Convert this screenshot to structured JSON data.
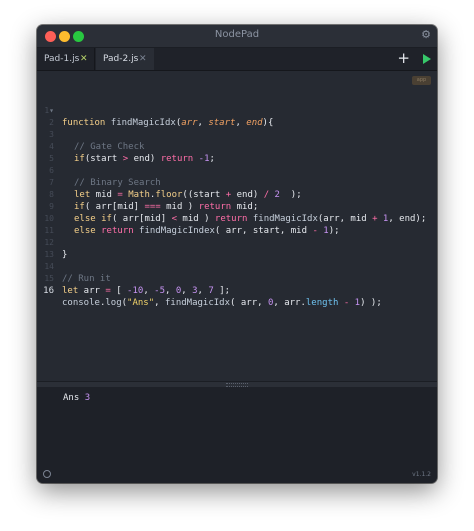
{
  "window": {
    "title": "NodePad"
  },
  "tabs": [
    {
      "label": "Pad-1.js",
      "close": "✕"
    },
    {
      "label": "Pad-2.js",
      "close": "✕"
    }
  ],
  "toolbar": {
    "add_label": "+",
    "settings_label": "⚙"
  },
  "editor": {
    "badge": "app",
    "line_numbers": [
      "1",
      "2",
      "3",
      "4",
      "5",
      "6",
      "7",
      "8",
      "9",
      "10",
      "11",
      "12",
      "13",
      "14",
      "15",
      "16"
    ],
    "active_line": "16",
    "fold_marker": "▾"
  },
  "code": {
    "l1": {
      "kw": "function",
      "name": "findMagicIdx",
      "open": "(",
      "p1": "arr",
      "c1": ", ",
      "p2": "start",
      "c2": ", ",
      "p3": "end",
      "close": "){"
    },
    "l3": "// Gate Check",
    "l4": {
      "kw": "if",
      "a": "(start ",
      "op": ">",
      "b": " end) ",
      "ret": "return",
      "c": " ",
      "n": "-1",
      "d": ";"
    },
    "l6": "// Binary Search",
    "l7": {
      "kw": "let",
      "a": " mid ",
      "eq": "=",
      "b": " ",
      "math": "Math",
      "dot": ".",
      "floor": "floor",
      "c": "((start ",
      "plus": "+",
      "d": " end) ",
      "div": "/",
      "e": " ",
      "two": "2",
      "f": "  );"
    },
    "l8": {
      "kw": "if",
      "a": "( arr[mid] ",
      "op": "===",
      "b": " mid ) ",
      "ret": "return",
      "c": " mid;"
    },
    "l9": {
      "kw1": "else",
      "s": " ",
      "kw2": "if",
      "a": "( arr[mid] ",
      "op": "<",
      "b": " mid ) ",
      "ret": "return",
      "c": " ",
      "fn": "findMagicIdx",
      "d": "(arr, mid ",
      "plus": "+",
      "e": " ",
      "one": "1",
      "f": ", end);"
    },
    "l10": {
      "kw1": "else",
      "s": " ",
      "ret": "return",
      "c": " ",
      "fn": "findMagicIndex",
      "d": "( arr, start, mid ",
      "minus": "-",
      "e": " ",
      "one": "1",
      "f": ");"
    },
    "l12": "}",
    "l14": "// Run it",
    "l15": {
      "kw": "let",
      "a": " arr ",
      "eq": "=",
      "b": " [ ",
      "n1": "-10",
      "c1": ", ",
      "n2": "-5",
      "c2": ", ",
      "n3": "0",
      "c3": ", ",
      "n4": "3",
      "c4": ", ",
      "n5": "7",
      "d": " ];"
    },
    "l16": {
      "obj": "console",
      "dot": ".",
      "meth": "log",
      "a": "(",
      "str": "\"Ans\"",
      "b": ", ",
      "fn": "findMagicIdx",
      "c": "( arr, ",
      "zero": "0",
      "d": ", arr.",
      "prop": "length",
      "e": " ",
      "minus": "-",
      "f": " ",
      "one": "1",
      "g": ") );"
    }
  },
  "console": {
    "label": "Ans",
    "value": "3"
  },
  "footer": {
    "version": "v1.1.2"
  },
  "colors": {
    "keyword": "#ff6ea8",
    "number": "#c693f2",
    "comment": "#6e7785",
    "param": "#f2a263",
    "run": "#37c86a"
  }
}
